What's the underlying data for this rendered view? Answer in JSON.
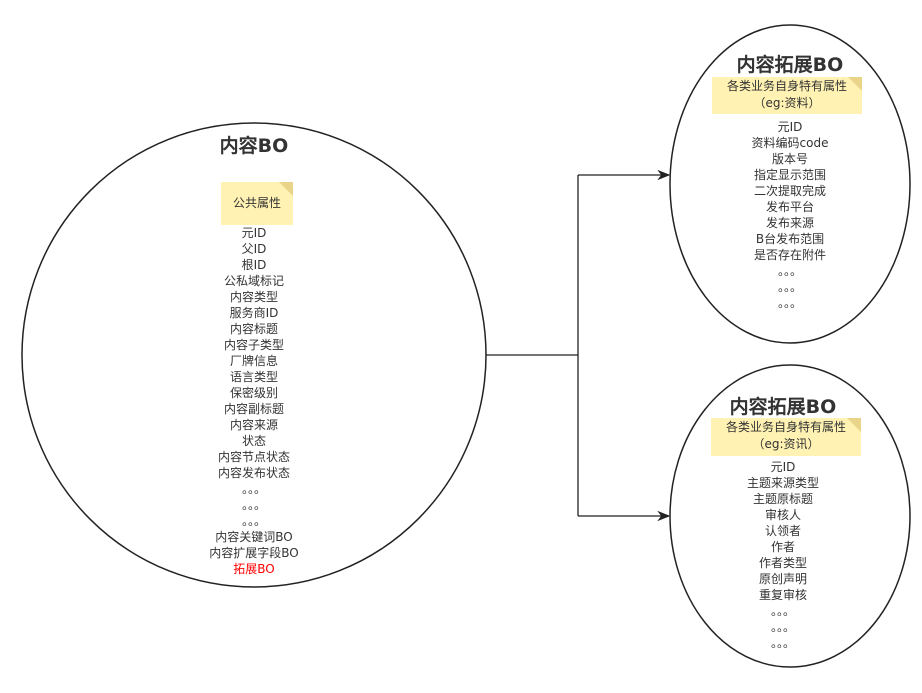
{
  "main": {
    "title": "内容BO",
    "note": "公共属性",
    "items": [
      "元ID",
      "父ID",
      "根ID",
      "公私域标记",
      "内容类型",
      "服务商ID",
      "内容标题",
      "内容子类型",
      "厂牌信息",
      "语言类型",
      "保密级别",
      "内容副标题",
      "内容来源",
      "状态",
      "内容节点状态",
      "内容发布状态",
      "。。。",
      "。。。",
      "。。。",
      "内容关键词BO",
      "内容扩展字段BO"
    ],
    "highlight_item": "拓展BO",
    "highlight_color": "#ff0000"
  },
  "ext1": {
    "title": "内容拓展BO",
    "note_line1": "各类业务自身特有属性",
    "note_line2": "（eg:资料）",
    "items": [
      "元ID",
      "资料编码code",
      "版本号",
      "指定显示范围",
      "二次提取完成",
      "发布平台",
      "发布来源",
      "B台发布范围",
      "是否存在附件",
      "。。。",
      "。。。",
      "。。。"
    ]
  },
  "ext2": {
    "title": "内容拓展BO",
    "note_line1": "各类业务自身特有属性",
    "note_line2": "（eg:资讯）",
    "items": [
      "元ID",
      "主题来源类型",
      "主题原标题",
      "审核人",
      "认领者",
      "作者",
      "作者类型",
      "原创声明",
      "重复审核",
      "。。。",
      "。。。",
      "。。。"
    ]
  },
  "colors": {
    "stroke": "#333333",
    "note_fill": "#fff2b3"
  }
}
